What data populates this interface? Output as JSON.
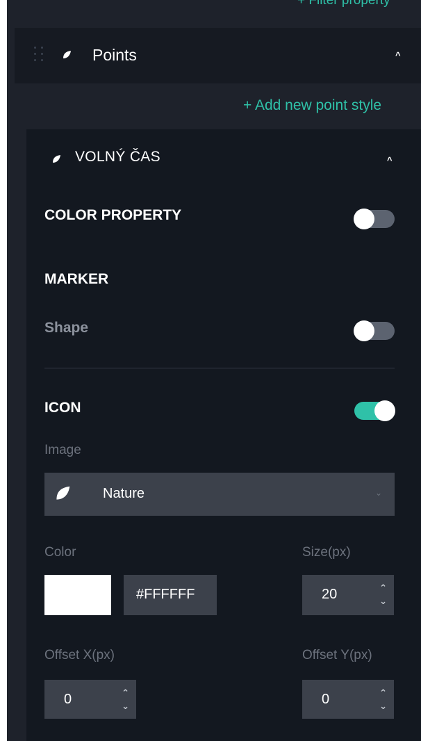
{
  "filter_link": "+ Filter property",
  "section": {
    "title": "Points",
    "add_label": "+ Add new point style"
  },
  "style_card": {
    "title": "VOLNÝ ČAS"
  },
  "color_property": {
    "label": "COLOR PROPERTY",
    "enabled": false
  },
  "marker": {
    "label": "MARKER",
    "shape_label": "Shape",
    "shape_enabled": false
  },
  "icon": {
    "label": "ICON",
    "enabled": true,
    "image_label": "Image",
    "image_value": "Nature",
    "color_label": "Color",
    "color_hex": "#FFFFFF",
    "size_label": "Size(px)",
    "size_value": "20",
    "offset_x_label": "Offset X(px)",
    "offset_x_value": "0",
    "offset_y_label": "Offset Y(px)",
    "offset_y_value": "0"
  },
  "colors": {
    "accent": "#2fc1a8",
    "panel": "#1e222b",
    "card": "#131820",
    "field": "#3c414b"
  }
}
